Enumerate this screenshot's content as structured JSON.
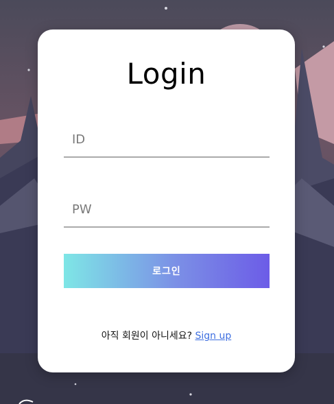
{
  "login": {
    "title": "Login",
    "id_placeholder": "ID",
    "pw_placeholder": "PW",
    "submit_label": "로그인",
    "signup_prompt": "아직 회원이 아니세요?",
    "signup_link": "Sign up"
  },
  "colors": {
    "button_gradient_start": "#7ee6e6",
    "button_gradient_end": "#6c5ce7",
    "link": "#3d6ee0",
    "background": "#4a4a60"
  }
}
